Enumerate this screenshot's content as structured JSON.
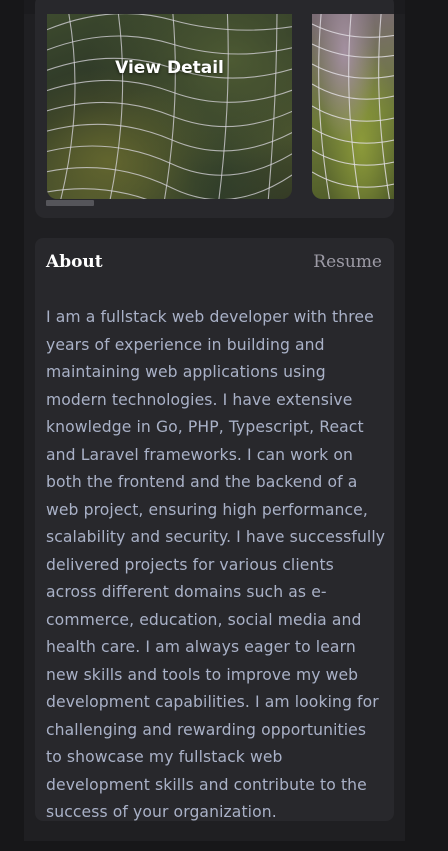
{
  "gallery": {
    "overlay_label": "View Detail"
  },
  "about": {
    "title": "About",
    "resume_label": "Resume",
    "text": "I am a fullstack web developer with three years of experience in building and maintaining web applications using modern technologies. I have extensive knowledge in Go, PHP, Typescript, React and Laravel frameworks. I can work on both the frontend and the backend of a web project, ensuring high performance, scalability and security. I have successfully delivered projects for various clients across different domains such as e-commerce, education, social media and health care. I am always eager to learn new skills and tools to improve my web development capabilities. I am looking for challenging and rewarding opportunities to showcase my fullstack web development skills and contribute to the success of your organization."
  },
  "colors": {
    "page_bg": "#171719",
    "column_bg": "#1f1f22",
    "card_bg": "#28282c",
    "body_text": "#a9b1c7",
    "link_muted": "#9d9ba6",
    "heading": "#ffffff"
  },
  "icons": {
    "slide_image": "dewy-spider-web-image"
  }
}
